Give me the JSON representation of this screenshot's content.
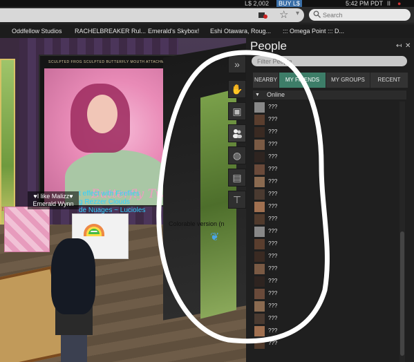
{
  "topbar": {
    "balance": "L$ 2,002",
    "buy_label": "BUY L$",
    "time": "5:42 PM PDT",
    "pause_glyph": "II"
  },
  "navbar": {
    "search_placeholder": "Search"
  },
  "bookmarks": [
    "Oddfellow  Studios",
    "RACHELBREAKER Rul...",
    "Emerald's Skybox!",
    "Eshi Otawara, Roug...",
    "::: Omega Point ::: D..."
  ],
  "scene": {
    "poster_title": "SCULPTED FROG SCULPTED BUTTERFLY MOUTH ATTACHMENT",
    "poster_script": "Butterfly Twig",
    "left_poster_text": "ns",
    "nametag_lines": [
      "♥I like Malizz♥",
      "Emerald Wynn"
    ],
    "float_text_lines": [
      "t effect with Fireflies",
      "g Rezzer Clouds",
      "de Nuages ~ Lucioles"
    ],
    "cover_label": "Colorable version (n"
  },
  "sidebar_tabs": [
    "expand",
    "hand",
    "person-card",
    "people",
    "globe",
    "briefcase",
    "shirt"
  ],
  "people_panel": {
    "title": "People",
    "filter_placeholder": "Filter People",
    "tabs": [
      {
        "label": "NEARBY",
        "selected": false
      },
      {
        "label": "MY FRIENDS",
        "selected": true
      },
      {
        "label": "MY GROUPS",
        "selected": false
      },
      {
        "label": "RECENT",
        "selected": false
      }
    ],
    "online_header": "Online",
    "friends": [
      {
        "name": "???"
      },
      {
        "name": "???"
      },
      {
        "name": "???"
      },
      {
        "name": "???"
      },
      {
        "name": "???"
      },
      {
        "name": "???"
      },
      {
        "name": "???"
      },
      {
        "name": "???"
      },
      {
        "name": "???"
      },
      {
        "name": "???"
      },
      {
        "name": "???"
      },
      {
        "name": "???"
      },
      {
        "name": "???"
      },
      {
        "name": "???"
      },
      {
        "name": "???"
      },
      {
        "name": "???"
      },
      {
        "name": "???"
      },
      {
        "name": "???"
      },
      {
        "name": "???"
      },
      {
        "name": "???"
      }
    ]
  },
  "colors": {
    "selected_tab": "#3d7d68",
    "float_text": "#2fd0ff",
    "annotation": "#ffffff"
  }
}
